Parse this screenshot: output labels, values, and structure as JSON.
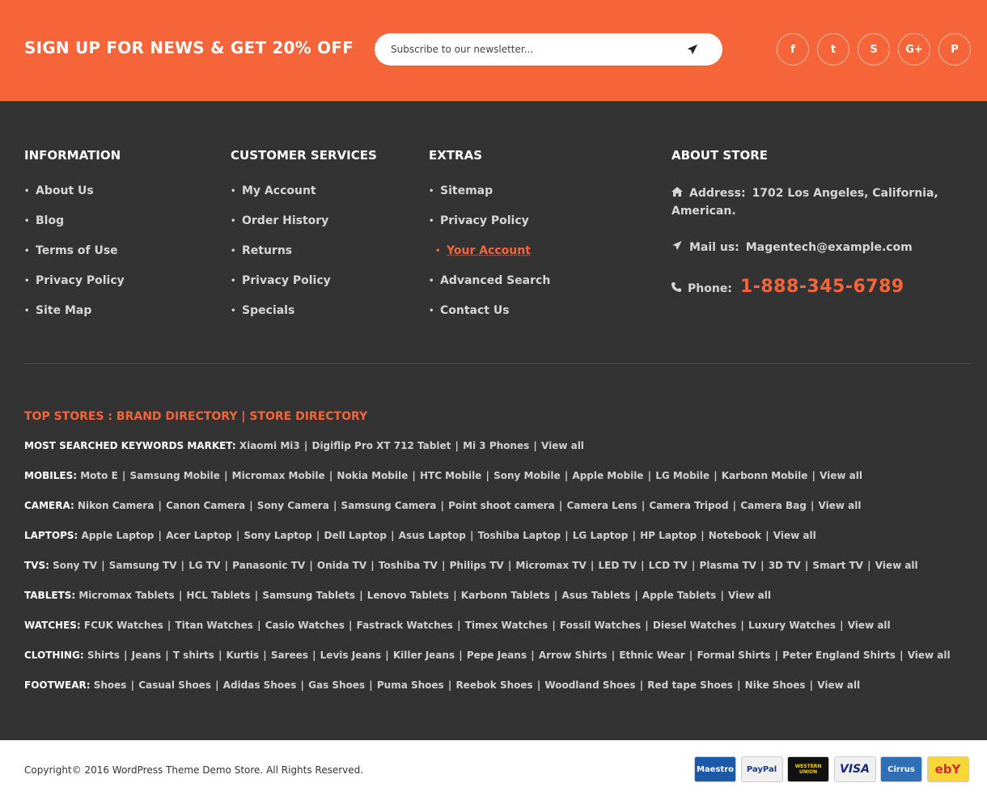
{
  "newsletter": {
    "title": "SIGN UP FOR NEWS & GET 20% OFF",
    "placeholder": "Subscribe to our newsletter...",
    "send_icon": "paper-plane-icon",
    "socials": [
      {
        "name": "facebook",
        "glyph": "f"
      },
      {
        "name": "twitter",
        "glyph": "t"
      },
      {
        "name": "skype",
        "glyph": "S"
      },
      {
        "name": "google-plus",
        "glyph": "G+"
      },
      {
        "name": "pinterest",
        "glyph": "P"
      }
    ]
  },
  "information": {
    "title": "INFORMATION",
    "items": [
      "About Us",
      "Blog",
      "Terms of Use",
      "Privacy Policy",
      "Site Map"
    ]
  },
  "customer_services": {
    "title": "CUSTOMER SERVICES",
    "items": [
      "My Account",
      "Order History",
      "Returns",
      "Privacy Policy",
      "Specials"
    ]
  },
  "extras": {
    "title": "EXTRAS",
    "items": [
      "Sitemap",
      "Privacy Policy",
      "Your Account",
      "Advanced Search",
      "Contact Us"
    ],
    "active_index": 2
  },
  "about": {
    "title": "ABOUT STORE",
    "address_label": "Address:",
    "address_line1": "1702 Los Angeles, California,",
    "address_line2": "American.",
    "mail_label": "Mail us:",
    "mail_value": "Magentech@example.com",
    "phone_label": "Phone:",
    "phone_value": "1-888-345-6789"
  },
  "top_stores": {
    "prefix": "TOP STORES : ",
    "brand": "BRAND DIRECTORY",
    "sep": " | ",
    "store": "STORE DIRECTORY"
  },
  "keyword_rows": [
    {
      "label": "MOST SEARCHED KEYWORDS MARKET:",
      "links": [
        "Xiaomi Mi3",
        "Digiflip Pro XT 712 Tablet",
        "Mi 3 Phones",
        "View all"
      ]
    },
    {
      "label": "MOBILES:",
      "links": [
        "Moto E",
        "Samsung Mobile",
        "Micromax Mobile",
        "Nokia Mobile",
        "HTC Mobile",
        "Sony Mobile",
        "Apple Mobile",
        "LG Mobile",
        "Karbonn Mobile",
        "View all"
      ]
    },
    {
      "label": "CAMERA:",
      "links": [
        "Nikon Camera",
        "Canon Camera",
        "Sony Camera",
        "Samsung Camera",
        "Point shoot camera",
        "Camera Lens",
        "Camera Tripod",
        "Camera Bag",
        "View all"
      ]
    },
    {
      "label": "LAPTOPS:",
      "links": [
        "Apple Laptop",
        "Acer Laptop",
        "Sony Laptop",
        "Dell Laptop",
        "Asus Laptop",
        "Toshiba Laptop",
        "LG Laptop",
        "HP Laptop",
        "Notebook",
        "View all"
      ]
    },
    {
      "label": "TVS:",
      "links": [
        "Sony TV",
        "Samsung TV",
        "LG TV",
        "Panasonic TV",
        "Onida TV",
        "Toshiba TV",
        "Philips TV",
        "Micromax TV",
        "LED TV",
        "LCD TV",
        "Plasma TV",
        "3D TV",
        "Smart TV",
        "View all"
      ]
    },
    {
      "label": "TABLETS:",
      "links": [
        "Micromax Tablets",
        "HCL Tablets",
        "Samsung Tablets",
        "Lenovo Tablets",
        "Karbonn Tablets",
        "Asus Tablets",
        "Apple Tablets",
        "View all"
      ]
    },
    {
      "label": "WATCHES:",
      "links": [
        "FCUK Watches",
        "Titan Watches",
        "Casio Watches",
        "Fastrack Watches",
        "Timex Watches",
        "Fossil Watches",
        "Diesel Watches",
        "Luxury Watches",
        "View all"
      ]
    },
    {
      "label": "CLOTHING:",
      "links": [
        "Shirts",
        "Jeans",
        "T shirts",
        "Kurtis",
        "Sarees",
        "Levis Jeans",
        "Killer Jeans",
        "Pepe Jeans",
        "Arrow Shirts",
        "Ethnic Wear",
        "Formal Shirts",
        "Peter England Shirts",
        "View all"
      ]
    },
    {
      "label": "FOOTWEAR:",
      "links": [
        "Shoes",
        "Casual Shoes",
        "Adidas Shoes",
        "Gas Shoes",
        "Puma Shoes",
        "Reebok Shoes",
        "Woodland Shoes",
        "Red tape Shoes",
        "Nike Shoes",
        "View all"
      ]
    }
  ],
  "copyright": "Copyright© 2016 WordPress Theme Demo Store. All Rights Reserved.",
  "payments": [
    {
      "name": "maestro",
      "label": "Maestro",
      "bg": "#1a5aa8",
      "fg": "#ffffff"
    },
    {
      "name": "paypal",
      "label": "PayPal",
      "bg": "#f0f0f0",
      "fg": "#1a3a8a"
    },
    {
      "name": "western-union",
      "label": "WESTERN UNION",
      "bg": "#111111",
      "fg": "#f5d000"
    },
    {
      "name": "visa",
      "label": "VISA",
      "bg": "#f0f0f0",
      "fg": "#1a2a7a"
    },
    {
      "name": "cirrus",
      "label": "Cirrus",
      "bg": "#2f6fb5",
      "fg": "#ffffff"
    },
    {
      "name": "ebay",
      "label": "ebY",
      "bg": "#f7d63a",
      "fg": "#d9282f"
    }
  ],
  "colors": {
    "accent": "#f66539",
    "footer_bg": "#333333"
  }
}
